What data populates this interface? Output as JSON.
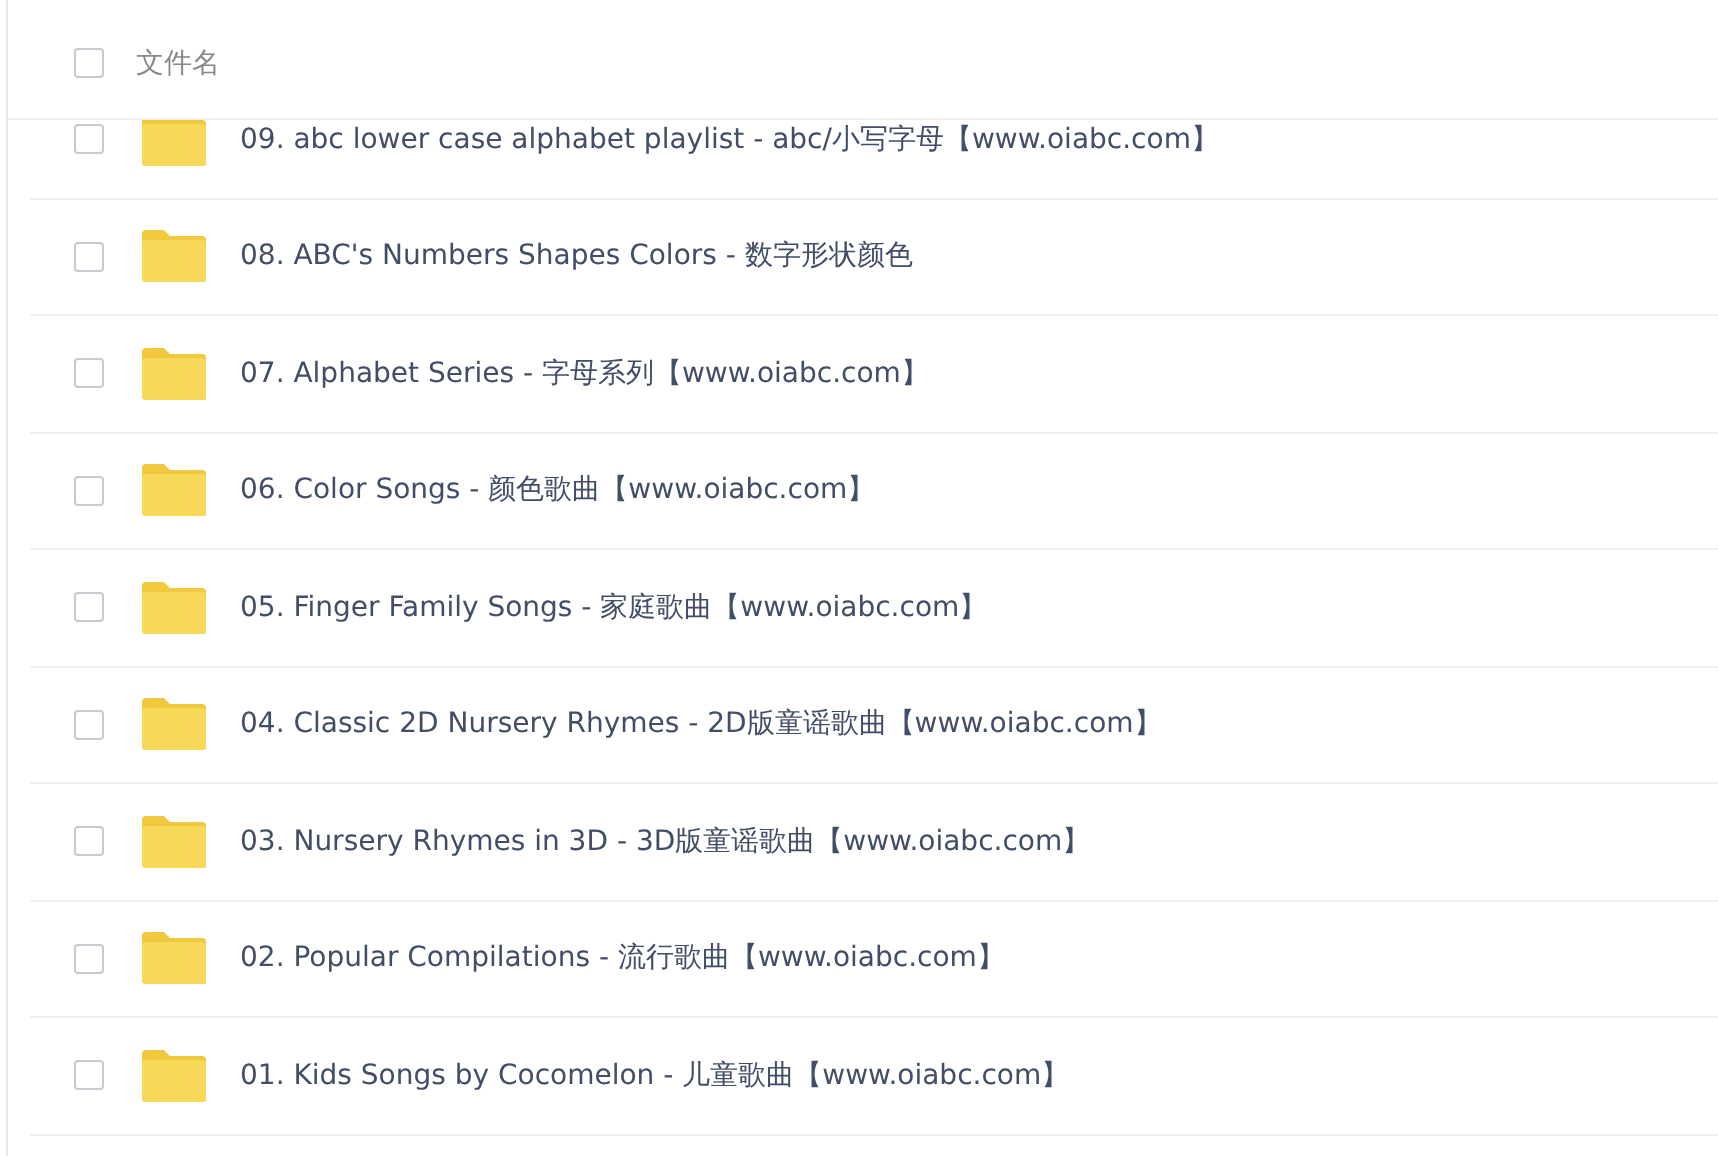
{
  "header": {
    "label": "文件名",
    "selected": false
  },
  "files": [
    {
      "name": "09. abc lower case alphabet playlist - abc/小写字母【www.oiabc.com】",
      "selected": false
    },
    {
      "name": "08. ABC's Numbers Shapes Colors - 数字形状颜色",
      "selected": false
    },
    {
      "name": "07. Alphabet Series - 字母系列【www.oiabc.com】",
      "selected": false
    },
    {
      "name": "06. Color Songs - 颜色歌曲【www.oiabc.com】",
      "selected": false
    },
    {
      "name": "05. Finger Family Songs - 家庭歌曲【www.oiabc.com】",
      "selected": false
    },
    {
      "name": "04. Classic 2D Nursery Rhymes - 2D版童谣歌曲【www.oiabc.com】",
      "selected": false
    },
    {
      "name": "03. Nursery Rhymes in 3D - 3D版童谣歌曲【www.oiabc.com】",
      "selected": false
    },
    {
      "name": "02. Popular Compilations - 流行歌曲【www.oiabc.com】",
      "selected": false
    },
    {
      "name": "01. Kids Songs by Cocomelon - 儿童歌曲【www.oiabc.com】",
      "selected": false
    }
  ]
}
